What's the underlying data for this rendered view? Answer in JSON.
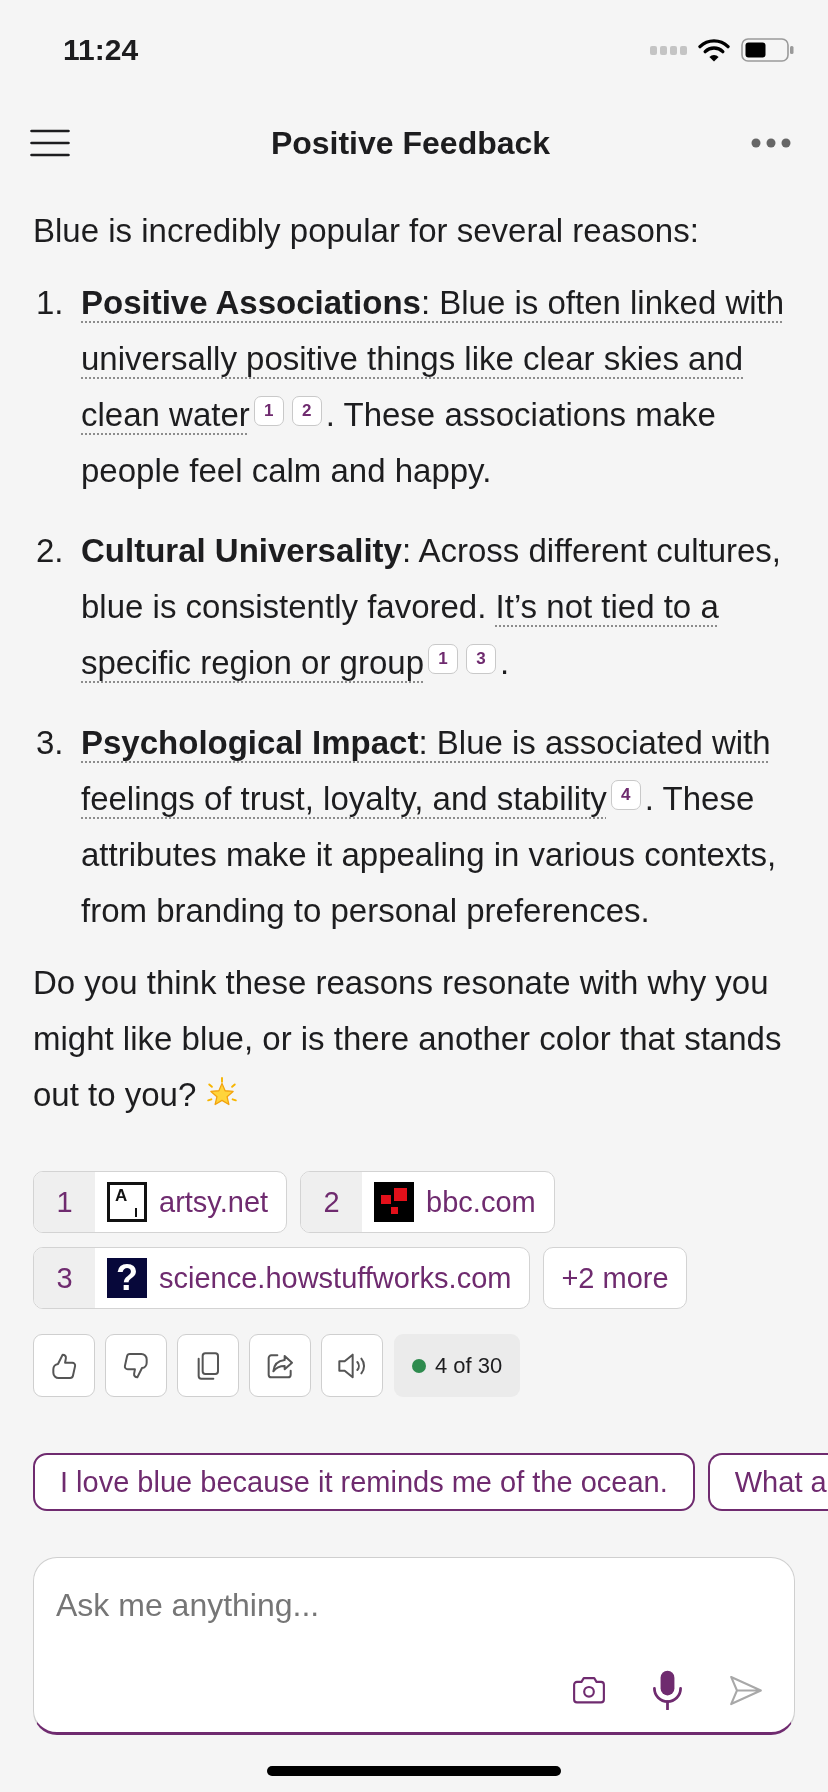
{
  "status_bar": {
    "time": "11:24"
  },
  "header": {
    "title": "Positive Feedback"
  },
  "message": {
    "intro": "Blue is incredibly popular for several reasons:",
    "points": [
      {
        "number": "1.",
        "segments": [
          {
            "kind": "cited",
            "text": "**Positive Associations**: Blue is often linked with universally positive things like clear skies and clean water"
          },
          {
            "kind": "citation",
            "label": "1"
          },
          {
            "kind": "citation",
            "label": "2"
          },
          {
            "kind": "text",
            "text": ". These associations make people feel calm and happy."
          }
        ]
      },
      {
        "number": "2.",
        "segments": [
          {
            "kind": "text",
            "text": "**Cultural Universality**: Across different cultures, blue is consistently favored. "
          },
          {
            "kind": "cited",
            "text": "It’s not tied to a specific region or group"
          },
          {
            "kind": "citation",
            "label": "1"
          },
          {
            "kind": "citation",
            "label": "3"
          },
          {
            "kind": "text",
            "text": "."
          }
        ]
      },
      {
        "number": "3.",
        "segments": [
          {
            "kind": "cited",
            "text": "**Psychological Impact**: Blue is associated with feelings of trust, loyalty, and stability"
          },
          {
            "kind": "citation",
            "label": "4"
          },
          {
            "kind": "text",
            "text": ". These attributes make it appealing in various contexts, from branding to personal preferences."
          }
        ]
      }
    ],
    "closing": "Do you think these reasons resonate with why you might like blue, or is there another color that stands out to you?"
  },
  "sources": {
    "items": [
      {
        "number": "1",
        "favicon": {
          "kind": "outlined",
          "text": "A"
        },
        "site": "artsy.net"
      },
      {
        "number": "2",
        "favicon": {
          "kind": "blocks"
        },
        "site": "bbc.com"
      },
      {
        "number": "3",
        "favicon": {
          "kind": "filled",
          "text": "?"
        },
        "site": "science.howstuffworks.com"
      }
    ],
    "more": "+2 more"
  },
  "actions": {
    "counter": "4 of 30"
  },
  "suggestions": [
    "I love blue because it reminds me of the ocean.",
    "What a"
  ],
  "composer": {
    "placeholder": "Ask me anything..."
  }
}
